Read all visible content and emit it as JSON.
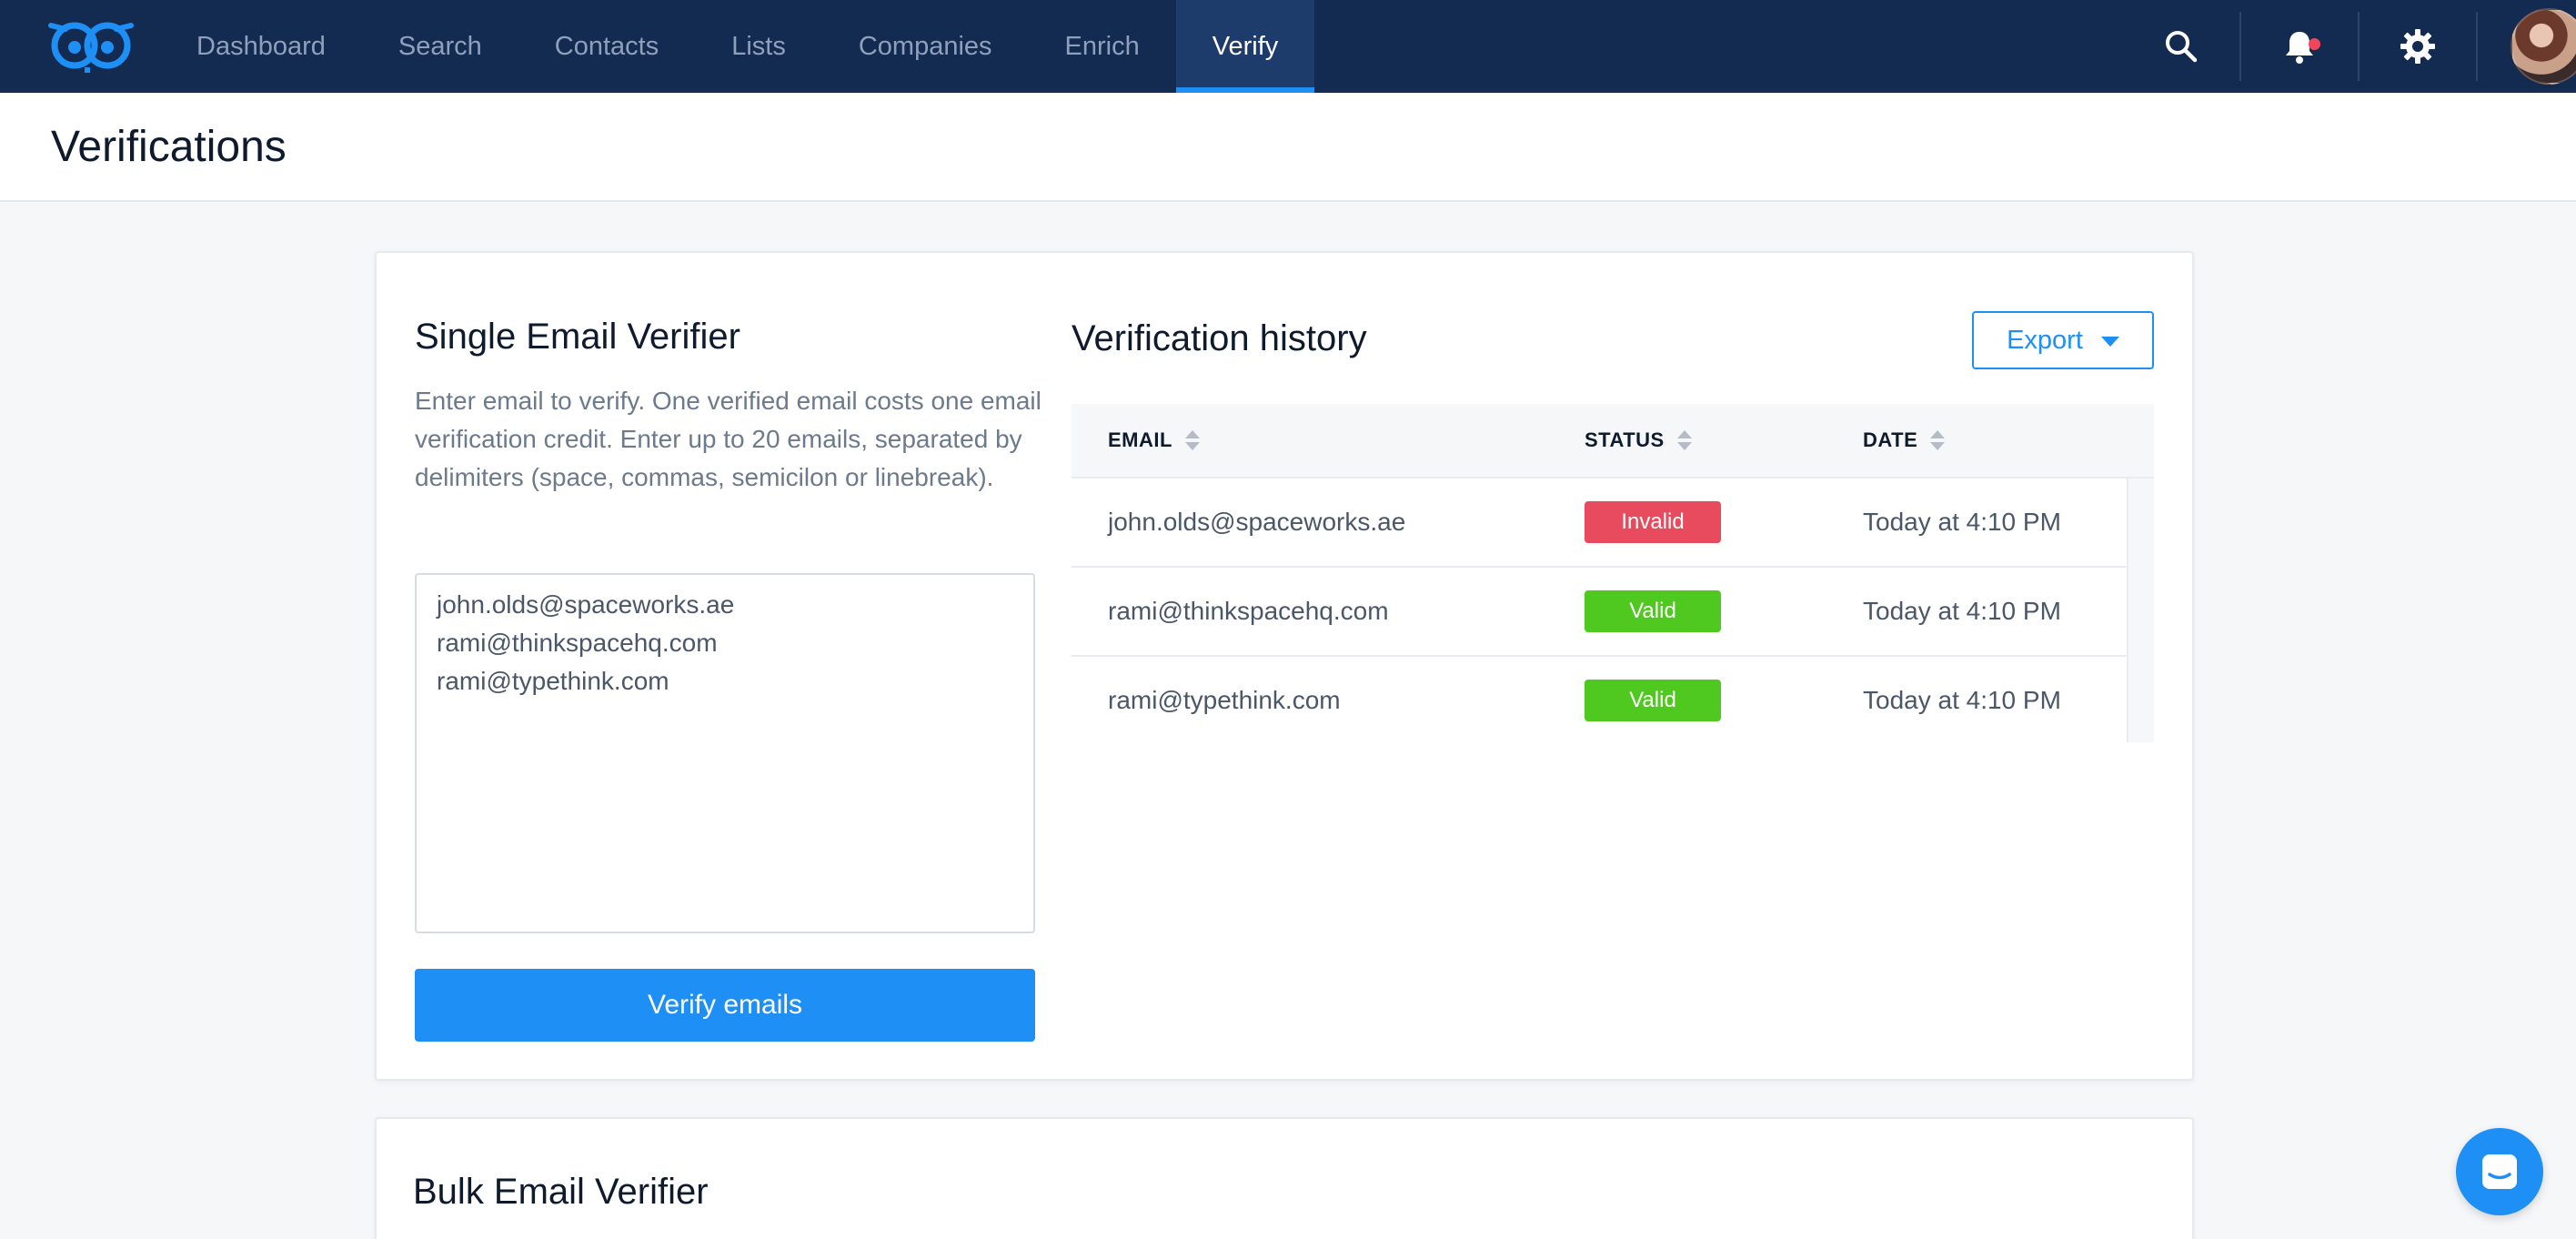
{
  "nav": {
    "items": [
      {
        "label": "Dashboard"
      },
      {
        "label": "Search"
      },
      {
        "label": "Contacts"
      },
      {
        "label": "Lists"
      },
      {
        "label": "Companies"
      },
      {
        "label": "Enrich"
      },
      {
        "label": "Verify"
      }
    ],
    "active": "Verify",
    "icons": [
      "search-icon",
      "bell-icon",
      "gear-icon"
    ]
  },
  "page": {
    "title": "Verifications"
  },
  "single_verifier": {
    "title": "Single Email Verifier",
    "description": "Enter email to verify. One verified email costs one email verification credit. Enter up to 20 emails, separated by delimiters (space, commas, semicilon or linebreak).",
    "input_value": "john.olds@spaceworks.ae\nrami@thinkspacehq.com\nrami@typethink.com",
    "button_label": "Verify emails"
  },
  "history": {
    "title": "Verification history",
    "export_label": "Export",
    "columns": {
      "email": "EMAIL",
      "status": "STATUS",
      "date": "DATE"
    },
    "rows": [
      {
        "email": "john.olds@spaceworks.ae",
        "status": "Invalid",
        "date": "Today at 4:10 PM"
      },
      {
        "email": "rami@thinkspacehq.com",
        "status": "Valid",
        "date": "Today at 4:10 PM"
      },
      {
        "email": "rami@typethink.com",
        "status": "Valid",
        "date": "Today at 4:10 PM"
      }
    ]
  },
  "bulk_verifier": {
    "title": "Bulk Email Verifier"
  },
  "colors": {
    "nav_bg": "#132a51",
    "accent": "#1e8ff5",
    "invalid": "#e94b5e",
    "valid": "#4fc91f"
  }
}
